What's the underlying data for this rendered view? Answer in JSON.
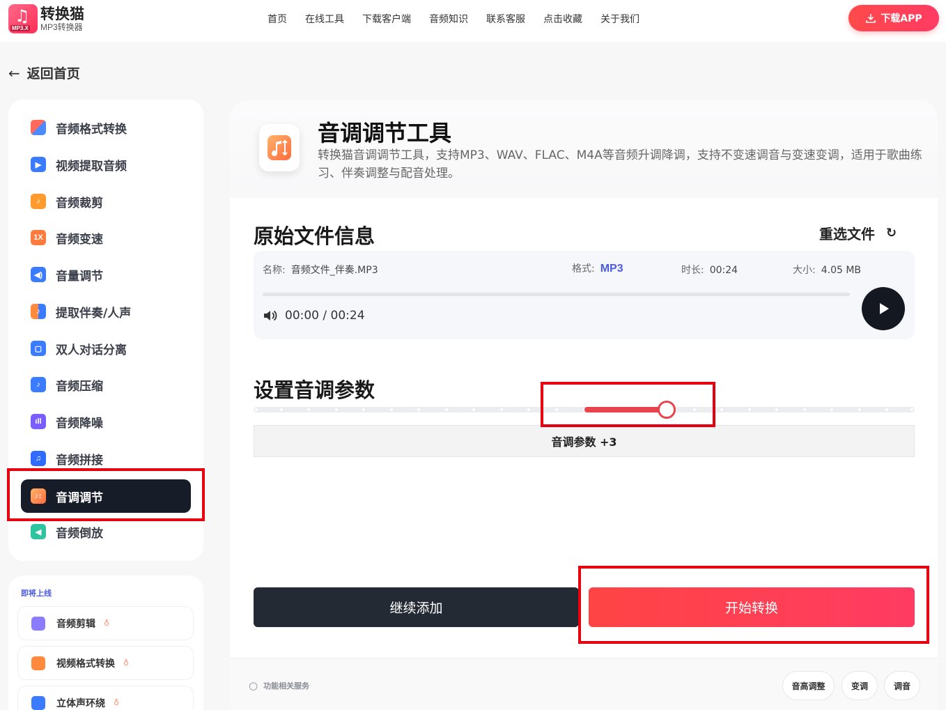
{
  "header": {
    "logo_name": "转换猫",
    "logo_sub": "MP3转换器",
    "logo_tag": "MP3.X",
    "nav": [
      "首页",
      "在线工具",
      "下载客户端",
      "音频知识",
      "联系客服",
      "点击收藏",
      "关于我们"
    ],
    "download_label": "下载APP"
  },
  "back_label": "返回首页",
  "sidebar": {
    "items": [
      {
        "label": "音频格式转换",
        "icon": "format-convert-icon",
        "color": "#ff6a5c"
      },
      {
        "label": "视频提取音频",
        "icon": "video-extract-icon",
        "color": "#3b7bff"
      },
      {
        "label": "音频裁剪",
        "icon": "audio-cut-icon",
        "color": "#ff9a2e"
      },
      {
        "label": "音频变速",
        "icon": "speed-icon",
        "color": "#ff7a3d",
        "glyph": "1X"
      },
      {
        "label": "音量调节",
        "icon": "volume-icon",
        "color": "#3b7bff"
      },
      {
        "label": "提取伴奏/人声",
        "icon": "vocal-extract-icon",
        "color": "#ff8a3d"
      },
      {
        "label": "双人对话分离",
        "icon": "dialog-split-icon",
        "color": "#3b7bff"
      },
      {
        "label": "音频压缩",
        "icon": "compress-icon",
        "color": "#3b7bff"
      },
      {
        "label": "音频降噪",
        "icon": "denoise-icon",
        "color": "#7b5cff"
      },
      {
        "label": "音频拼接",
        "icon": "merge-icon",
        "color": "#2f6bff"
      },
      {
        "label": "音调调节",
        "icon": "pitch-icon",
        "color": "#ff7a3d"
      },
      {
        "label": "音频倒放",
        "icon": "reverse-icon",
        "color": "#2ec4a0"
      }
    ],
    "active_index": 10
  },
  "soon": {
    "title": "即将上线",
    "items": [
      {
        "label": "音频剪辑",
        "icon": "scissors-icon",
        "color": "#7b6cff"
      },
      {
        "label": "视频格式转换",
        "icon": "video-format-icon",
        "color": "#ff8a3d"
      },
      {
        "label": "立体声环绕",
        "icon": "stereo-icon",
        "color": "#3b7bff"
      }
    ]
  },
  "tool": {
    "title": "音调调节工具",
    "desc": "转换猫音调调节工具，支持MP3、WAV、FLAC、M4A等音频升调降调，支持不变速调音与变速变调，适用于歌曲练习、伴奏调整与配音处理。"
  },
  "file_info": {
    "section_title": "原始文件信息",
    "reselect_label": "重选文件",
    "name_key": "名称:",
    "name_val": "音频文件_伴奏.MP3",
    "format_key": "格式:",
    "format_val": "MP3",
    "duration_key": "时长:",
    "duration_val": "00:24",
    "size_key": "大小:",
    "size_val": "4.05 MB",
    "time_display": "00:00 / 00:24",
    "progress": 0
  },
  "pitch": {
    "section_title": "设置音调参数",
    "param_label": "音调参数 +3",
    "value": 3,
    "min": -12,
    "max": 12
  },
  "actions": {
    "continue_label": "继续添加",
    "start_label": "开始转换"
  },
  "footer": {
    "related_label": "功能相关服务",
    "chips": [
      "音高调整",
      "变调",
      "调音"
    ]
  },
  "colors": {
    "accent": "#ff3b63",
    "active_bg": "#171c29",
    "slider_fill": "#e9434d",
    "highlight": "#e6000f"
  }
}
